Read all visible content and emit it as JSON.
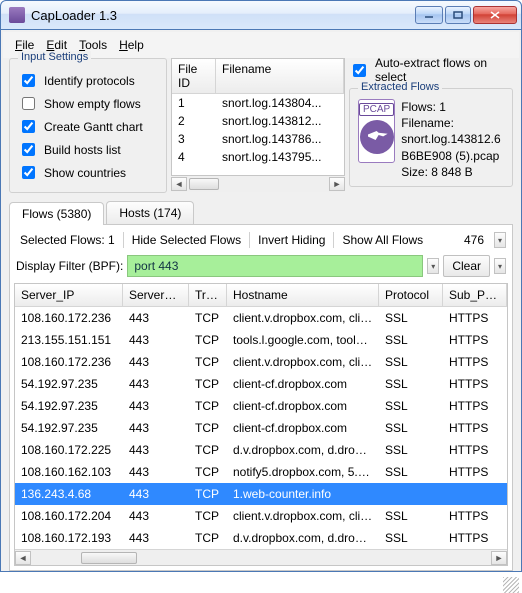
{
  "window": {
    "title": "CapLoader 1.3"
  },
  "menu": {
    "file": "File",
    "edit": "Edit",
    "tools": "Tools",
    "help": "Help"
  },
  "input_settings": {
    "legend": "Input Settings",
    "identify": "Identify protocols",
    "empty": "Show empty flows",
    "gantt": "Create Gantt chart",
    "hosts": "Build hosts list",
    "countries": "Show countries"
  },
  "filelist": {
    "cols": {
      "id": "File ID",
      "name": "Filename"
    },
    "rows": [
      {
        "id": "1",
        "name": "snort.log.143804..."
      },
      {
        "id": "2",
        "name": "snort.log.143812..."
      },
      {
        "id": "3",
        "name": "snort.log.143786..."
      },
      {
        "id": "4",
        "name": "snort.log.143795..."
      }
    ]
  },
  "extract": {
    "auto": "Auto-extract flows on select",
    "legend": "Extracted Flows",
    "pcap_label": "PCAP",
    "flows": "Flows: 1",
    "filename_label": "Filename:",
    "filename": "snort.log.143812.6B6BE908 (5).pcap",
    "size": "Size: 8 848 B"
  },
  "tabs": {
    "flows": "Flows (5380)",
    "hosts": "Hosts (174)"
  },
  "flowbar": {
    "selected": "Selected Flows:  1",
    "hide": "Hide Selected Flows",
    "invert": "Invert Hiding",
    "showall": "Show All Flows",
    "count": "476"
  },
  "filter": {
    "label": "Display Filter (BPF):",
    "value": "port 443",
    "clear": "Clear"
  },
  "grid": {
    "cols": {
      "ip": "Server_IP",
      "port": "Server_Port",
      "trans": "Trans",
      "host": "Hostname",
      "proto": "Protocol",
      "sub": "Sub_Protocol"
    },
    "rows": [
      {
        "ip": "108.160.172.236",
        "port": "443",
        "trans": "TCP",
        "host": "client.v.dropbox.com, clien...",
        "proto": "SSL",
        "sub": "HTTPS",
        "sel": false
      },
      {
        "ip": "213.155.151.151",
        "port": "443",
        "trans": "TCP",
        "host": "tools.l.google.com, tools.g...",
        "proto": "SSL",
        "sub": "HTTPS",
        "sel": false
      },
      {
        "ip": "108.160.172.236",
        "port": "443",
        "trans": "TCP",
        "host": "client.v.dropbox.com, clien...",
        "proto": "SSL",
        "sub": "HTTPS",
        "sel": false
      },
      {
        "ip": "54.192.97.235",
        "port": "443",
        "trans": "TCP",
        "host": "client-cf.dropbox.com",
        "proto": "SSL",
        "sub": "HTTPS",
        "sel": false
      },
      {
        "ip": "54.192.97.235",
        "port": "443",
        "trans": "TCP",
        "host": "client-cf.dropbox.com",
        "proto": "SSL",
        "sub": "HTTPS",
        "sel": false
      },
      {
        "ip": "54.192.97.235",
        "port": "443",
        "trans": "TCP",
        "host": "client-cf.dropbox.com",
        "proto": "SSL",
        "sub": "HTTPS",
        "sel": false
      },
      {
        "ip": "108.160.172.225",
        "port": "443",
        "trans": "TCP",
        "host": "d.v.dropbox.com, d.dropbo...",
        "proto": "SSL",
        "sub": "HTTPS",
        "sel": false
      },
      {
        "ip": "108.160.162.103",
        "port": "443",
        "trans": "TCP",
        "host": "notify5.dropbox.com, 5.noti...",
        "proto": "SSL",
        "sub": "HTTPS",
        "sel": false
      },
      {
        "ip": "136.243.4.68",
        "port": "443",
        "trans": "TCP",
        "host": "1.web-counter.info",
        "proto": "",
        "sub": "",
        "sel": true
      },
      {
        "ip": "108.160.172.204",
        "port": "443",
        "trans": "TCP",
        "host": "client.v.dropbox.com, clien...",
        "proto": "SSL",
        "sub": "HTTPS",
        "sel": false
      },
      {
        "ip": "108.160.172.193",
        "port": "443",
        "trans": "TCP",
        "host": "d.v.dropbox.com, d.dropbo...",
        "proto": "SSL",
        "sub": "HTTPS",
        "sel": false
      }
    ]
  }
}
